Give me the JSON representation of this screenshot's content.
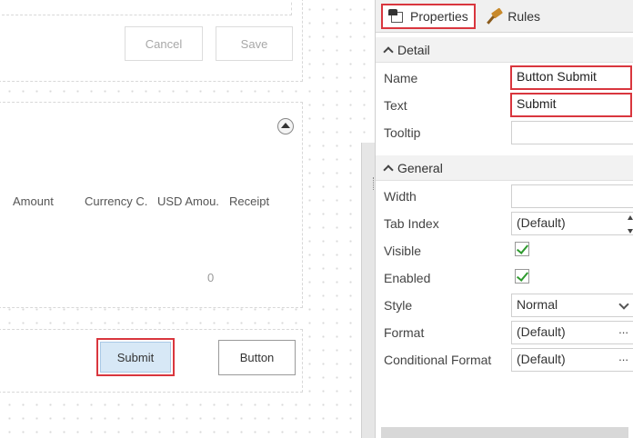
{
  "canvas": {
    "cancel_label": "Cancel",
    "save_label": "Save",
    "columns": [
      "Amount",
      "Currency C.",
      "USD Amou.",
      "Receipt"
    ],
    "zero_value": "0",
    "submit_label": "Submit",
    "button_label": "Button"
  },
  "properties_panel": {
    "tabs": [
      {
        "label": "Properties",
        "icon": "properties-icon",
        "active": true
      },
      {
        "label": "Rules",
        "icon": "gavel-icon",
        "active": false
      }
    ],
    "sections": {
      "detail": {
        "title": "Detail",
        "name_label": "Name",
        "name_value": "Button Submit",
        "text_label": "Text",
        "text_value": "Submit",
        "tooltip_label": "Tooltip",
        "tooltip_value": ""
      },
      "general": {
        "title": "General",
        "width_label": "Width",
        "width_value": "",
        "tab_index_label": "Tab Index",
        "tab_index_value": "(Default)",
        "visible_label": "Visible",
        "visible_checked": true,
        "enabled_label": "Enabled",
        "enabled_checked": true,
        "style_label": "Style",
        "style_value": "Normal",
        "format_label": "Format",
        "format_value": "(Default)",
        "conditional_format_label": "Conditional Format",
        "conditional_format_value": "(Default)",
        "ellipsis": "..."
      }
    }
  },
  "colors": {
    "highlight": "#d9363e",
    "submit_bg": "#d7e8f6",
    "check": "#2e9a2e"
  }
}
